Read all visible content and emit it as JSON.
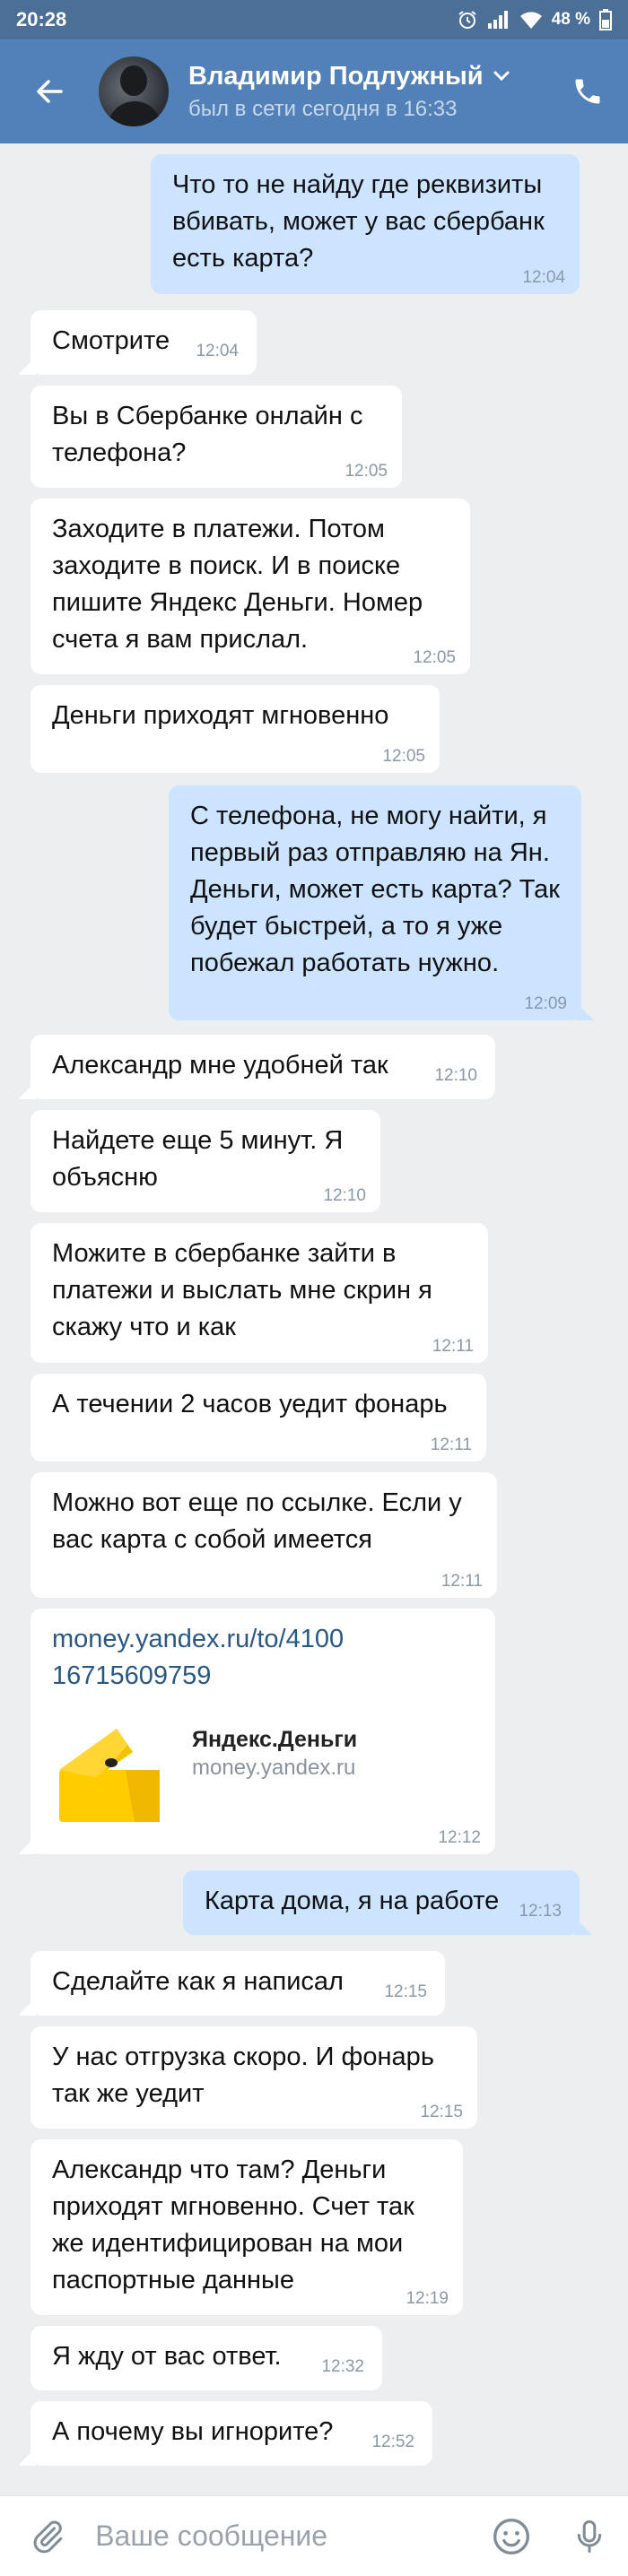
{
  "status_bar": {
    "time": "20:28",
    "battery": "48 %"
  },
  "header": {
    "contact_name": "Владимир Подлужный",
    "last_seen": "был в сети сегодня в 16:33"
  },
  "messages": [
    {
      "dir": "out",
      "text": "Что то не найду где реквизиты вбивать, может у вас сбербанк есть карта?",
      "time": "12:04"
    },
    {
      "dir": "in",
      "text": "Смотрите",
      "time": "12:04"
    },
    {
      "dir": "in",
      "text": "Вы в Сбербанке онлайн с телефона?",
      "time": "12:05"
    },
    {
      "dir": "in",
      "text": "Заходите в платежи. Потом заходите в поиск. И в поиске пишите Яндекс Деньги. Номер счета я вам прислал.",
      "time": "12:05"
    },
    {
      "dir": "in",
      "text": "Деньги приходят мгновенно",
      "time": "12:05"
    },
    {
      "dir": "out",
      "text": "С телефона, не могу найти, я первый раз отправляю на Ян. Деньги, может есть карта? Так будет быстрей, а то я уже побежал работать нужно.",
      "time": "12:09"
    },
    {
      "dir": "in",
      "text": "Александр мне удобней так",
      "time": "12:10"
    },
    {
      "dir": "in",
      "text": "Найдете еще 5 минут. Я объясню",
      "time": "12:10"
    },
    {
      "dir": "in",
      "text": "Можите в сбербанке зайти в платежи и выслать мне скрин я скажу что и как",
      "time": "12:11"
    },
    {
      "dir": "in",
      "text": "А течении 2 часов уедит фонарь",
      "time": "12:11"
    },
    {
      "dir": "in",
      "text": "Можно вот еще по ссылке. Если у вас карта с собой имеется",
      "time": "12:11"
    },
    {
      "dir": "in",
      "link": "money.yandex.ru/to/410016715609759",
      "link_site": "Яндекс.Деньги",
      "link_domain": "money.yandex.ru",
      "time": "12:12"
    },
    {
      "dir": "out",
      "text": "Карта дома, я на работе",
      "time": "12:13"
    },
    {
      "dir": "in",
      "text": "Сделайте как я написал",
      "time": "12:15"
    },
    {
      "dir": "in",
      "text": "У нас отгрузка скоро. И фонарь так же уедит",
      "time": "12:15"
    },
    {
      "dir": "in",
      "text": "Александр что там? Деньги приходят мгновенно. Счет так же идентифицирован на мои паспортные данные",
      "time": "12:19"
    },
    {
      "dir": "in",
      "text": "Я жду от вас ответ.",
      "time": "12:32"
    },
    {
      "dir": "in",
      "text": "А почему вы игнорите?",
      "time": "12:52"
    }
  ],
  "composer": {
    "placeholder": "Ваше сообщение"
  },
  "colors": {
    "header": "#5181b8",
    "status_bar": "#4c6f97",
    "bubble_out": "#cce4ff",
    "bubble_in": "#ffffff",
    "background": "#edeef0",
    "link": "#2a5885"
  },
  "icons": [
    "back-arrow-icon",
    "chevron-down-icon",
    "phone-icon",
    "alarm-icon",
    "signal-icon",
    "wifi-icon",
    "battery-icon",
    "paperclip-icon",
    "smile-icon",
    "microphone-icon",
    "yandex-wallet-icon"
  ]
}
